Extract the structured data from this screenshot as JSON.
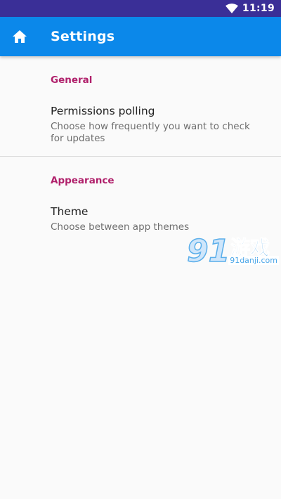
{
  "status_bar": {
    "time": "11:19",
    "background": "#3a2f97"
  },
  "app_bar": {
    "title": "Settings",
    "background": "#0b88ea",
    "icon": "home-icon"
  },
  "categories": [
    {
      "label": "General",
      "items": [
        {
          "title": "Permissions polling",
          "summary": "Choose how frequently you want to check for updates"
        }
      ]
    },
    {
      "label": "Appearance",
      "items": [
        {
          "title": "Theme",
          "summary": "Choose between app themes"
        }
      ]
    }
  ],
  "watermark": {
    "logo_text": "91游戏",
    "url": "91danji.com"
  },
  "colors": {
    "accent": "#b0206b",
    "title_text": "#212121",
    "summary_text": "#6e6e6e"
  }
}
